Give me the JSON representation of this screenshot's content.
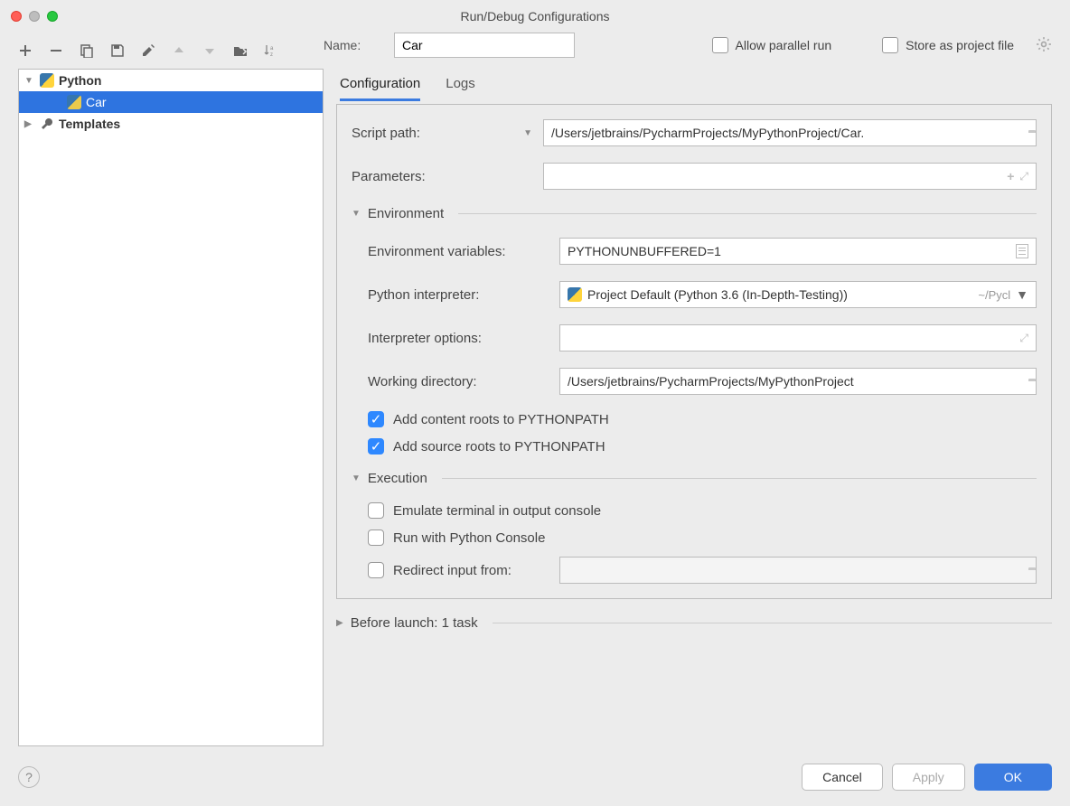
{
  "window": {
    "title": "Run/Debug Configurations"
  },
  "treeToolbar": {
    "add": "+",
    "remove": "−",
    "copy": "copy",
    "save": "save",
    "wrench": "settings",
    "up": "▲",
    "down": "▼",
    "folder": "folder",
    "sort": "sort"
  },
  "nameRow": {
    "label": "Name:",
    "value": "Car",
    "allowParallel": "Allow parallel run",
    "storeAsProject": "Store as project file"
  },
  "tree": {
    "python": "Python",
    "pythonChild": "Car",
    "templates": "Templates"
  },
  "tabs": {
    "configuration": "Configuration",
    "logs": "Logs"
  },
  "form": {
    "scriptPathLabel": "Script path:",
    "scriptPathValue": "/Users/jetbrains/PycharmProjects/MyPythonProject/Car.",
    "parametersLabel": "Parameters:",
    "parametersValue": "",
    "envSection": "Environment",
    "envVarsLabel": "Environment variables:",
    "envVarsValue": "PYTHONUNBUFFERED=1",
    "interpLabel": "Python interpreter:",
    "interpValue": "Project Default (Python 3.6 (In-Depth-Testing))",
    "interpSuffix": "~/Pycl",
    "interpOptsLabel": "Interpreter options:",
    "interpOptsValue": "",
    "workdirLabel": "Working directory:",
    "workdirValue": "/Users/jetbrains/PycharmProjects/MyPythonProject",
    "addContentRoots": "Add content roots to PYTHONPATH",
    "addSourceRoots": "Add source roots to PYTHONPATH",
    "execSection": "Execution",
    "emulateTerminal": "Emulate terminal in output console",
    "runPyConsole": "Run with Python Console",
    "redirectInput": "Redirect input from:",
    "beforeLaunch": "Before launch: 1 task"
  },
  "footer": {
    "cancel": "Cancel",
    "apply": "Apply",
    "ok": "OK"
  }
}
